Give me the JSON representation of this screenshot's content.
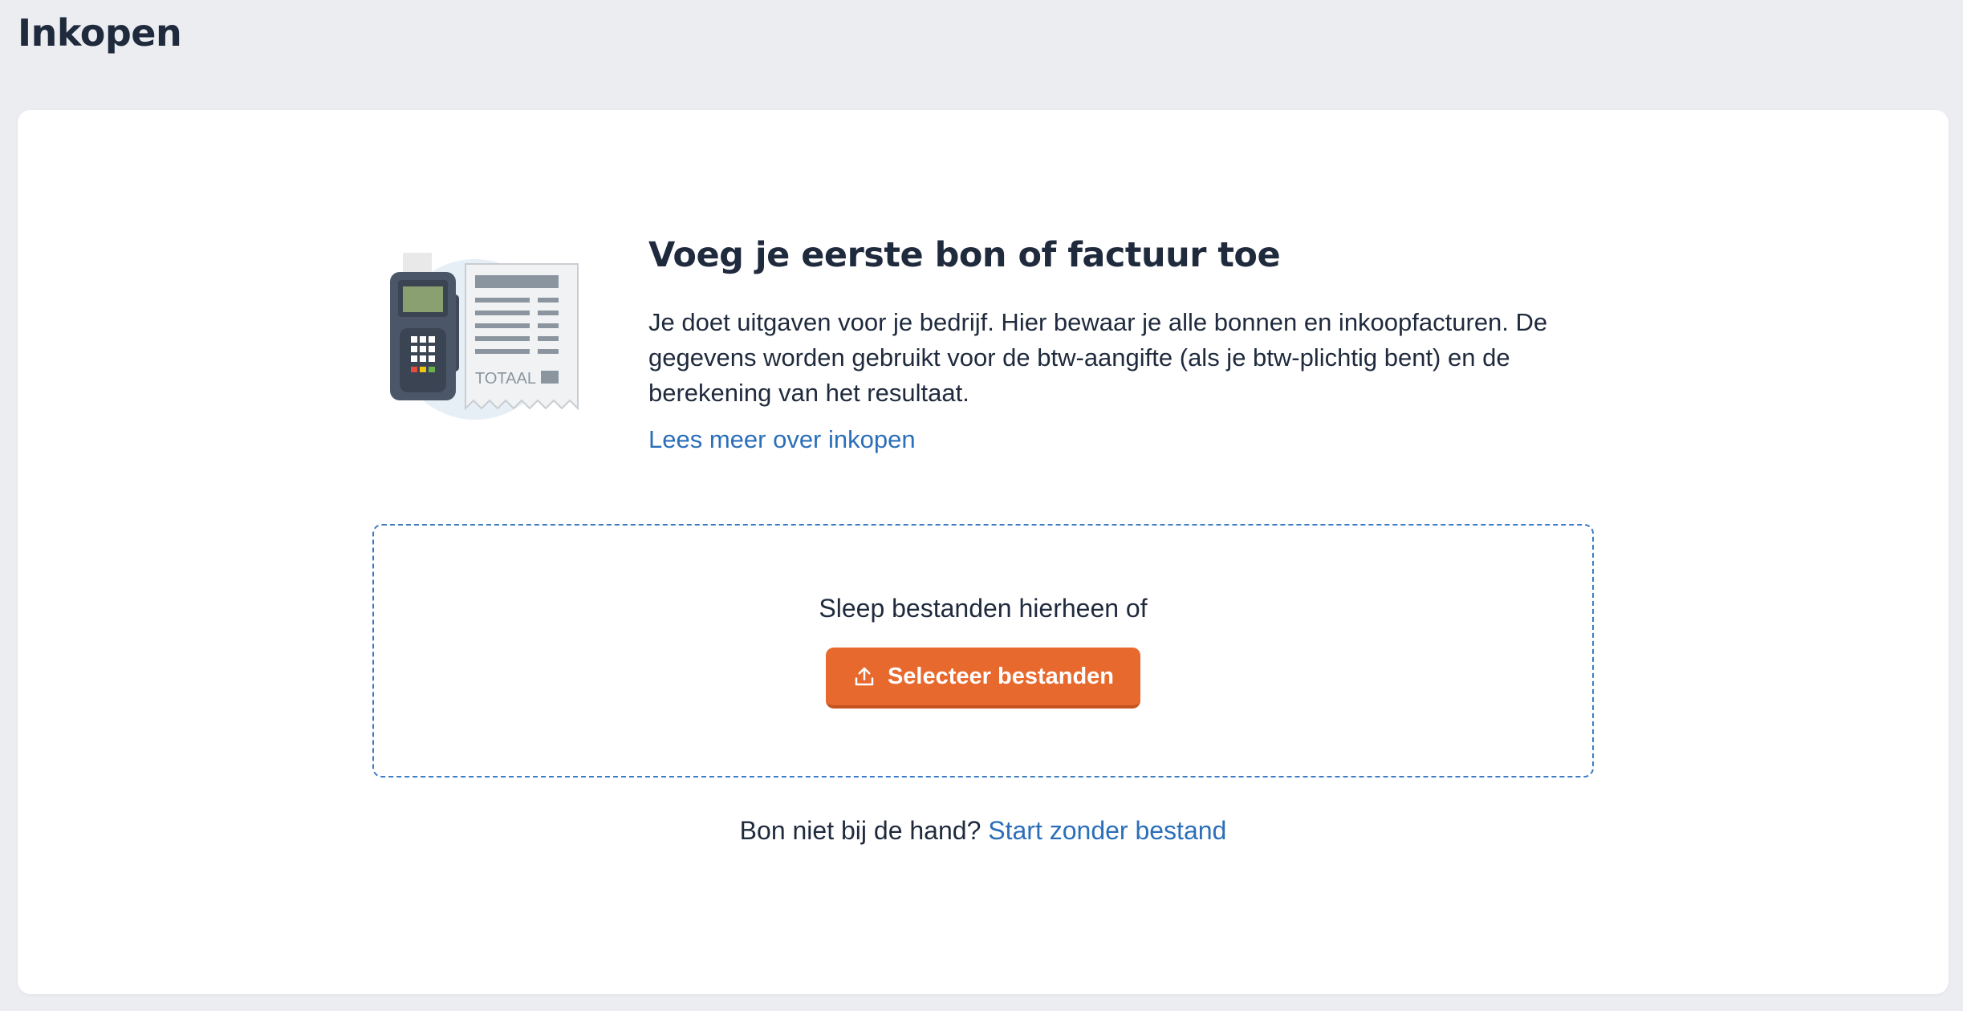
{
  "page": {
    "title": "Inkopen"
  },
  "empty_state": {
    "heading": "Voeg je eerste bon of factuur toe",
    "description": "Je doet uitgaven voor je bedrijf. Hier bewaar je alle bonnen en inkoopfacturen. De gegevens worden gebruikt voor de btw-aangifte (als je btw-plichtig bent) en de berekening van het resultaat.",
    "learn_more_link": "Lees meer over inkopen",
    "illustration": {
      "icon": "payment-terminal-receipt-illustration",
      "receipt_label": "TOTAAL"
    }
  },
  "dropzone": {
    "hint": "Sleep bestanden hierheen of",
    "button_label": "Selecteer bestanden",
    "button_icon": "upload-icon"
  },
  "footer": {
    "question": "Bon niet bij de hand?",
    "link": "Start zonder bestand"
  },
  "colors": {
    "background": "#ebedf1",
    "card": "#ffffff",
    "text": "#1f2a3d",
    "link": "#2c6fb9",
    "accent": "#e8692d",
    "dropzone_border": "#3d7dc4"
  }
}
